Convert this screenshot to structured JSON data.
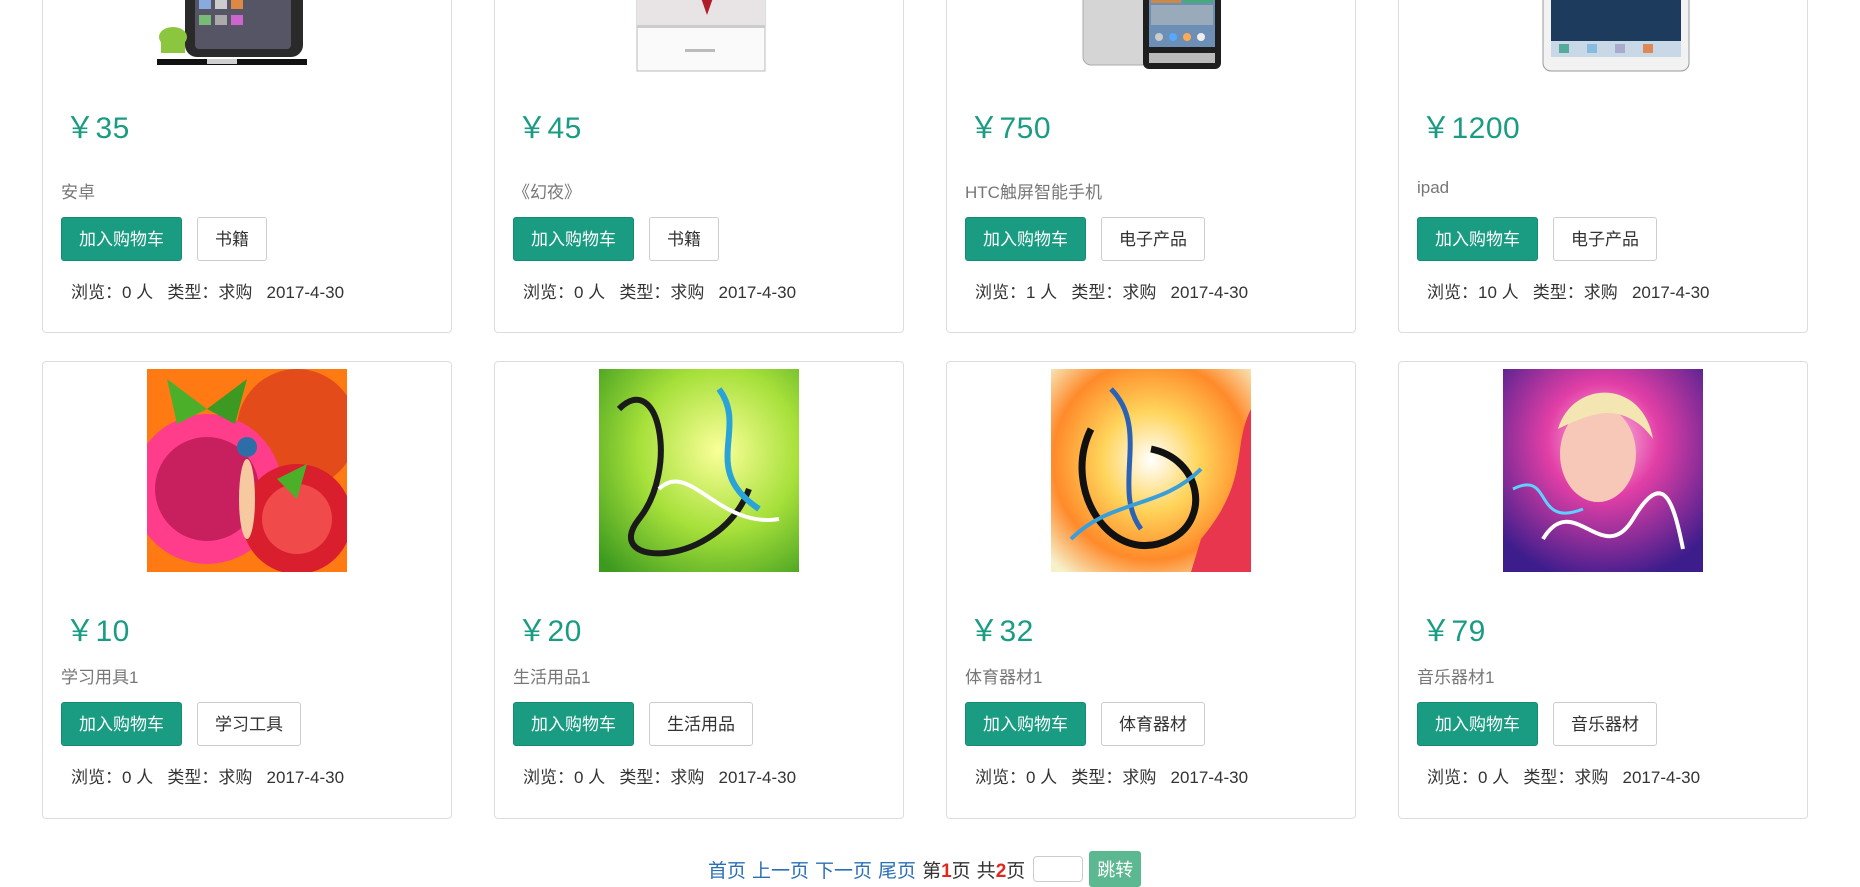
{
  "products_row1": [
    {
      "price": "￥35",
      "name": "安卓",
      "cart_label": "加入购物车",
      "tag": "书籍",
      "meta": "浏览：0 人   类型：求购   2017-4-30",
      "image": "android-phone-image"
    },
    {
      "price": "￥45",
      "name": "《幻夜》",
      "cart_label": "加入购物车",
      "tag": "书籍",
      "meta": "浏览：0 人   类型：求购   2017-4-30",
      "image": "book-image"
    },
    {
      "price": "￥750",
      "name": "HTC触屏智能手机",
      "cart_label": "加入购物车",
      "tag": "电子产品",
      "meta": "浏览：1 人   类型：求购   2017-4-30",
      "image": "htc-phone-image"
    },
    {
      "price": "￥1200",
      "name": "ipad",
      "cart_label": "加入购物车",
      "tag": "电子产品",
      "meta": "浏览：10 人   类型：求购   2017-4-30",
      "image": "ipad-image"
    }
  ],
  "products_row2": [
    {
      "price": "￥10",
      "name": "学习用具1",
      "cart_label": "加入购物车",
      "tag": "学习工具",
      "meta": "浏览：0 人   类型：求购   2017-4-30",
      "image": "butterfly-art-image"
    },
    {
      "price": "￥20",
      "name": "生活用品1",
      "cart_label": "加入购物车",
      "tag": "生活用品",
      "meta": "浏览：0 人   类型：求购   2017-4-30",
      "image": "green-swirl-art-image"
    },
    {
      "price": "￥32",
      "name": "体育器材1",
      "cart_label": "加入购物车",
      "tag": "体育器材",
      "meta": "浏览：0 人   类型：求购   2017-4-30",
      "image": "abstract-swirl-art-image"
    },
    {
      "price": "￥79",
      "name": "音乐器材1",
      "cart_label": "加入购物车",
      "tag": "音乐器材",
      "meta": "浏览：0 人   类型：求购   2017-4-30",
      "image": "neon-portrait-art-image"
    }
  ],
  "pagination": {
    "first": "首页",
    "prev": "上一页",
    "next": "下一页",
    "last": "尾页",
    "page_prefix": "第",
    "current_page": "1",
    "page_suffix": "页",
    "total_prefix": "共",
    "total_pages": "2",
    "total_suffix": "页",
    "input_value": "",
    "jump_label": "跳转"
  },
  "colors": {
    "accent": "#1a9c83",
    "link": "#2a6fb5",
    "page_highlight": "#e0281e",
    "jump_button": "#5cb890"
  }
}
